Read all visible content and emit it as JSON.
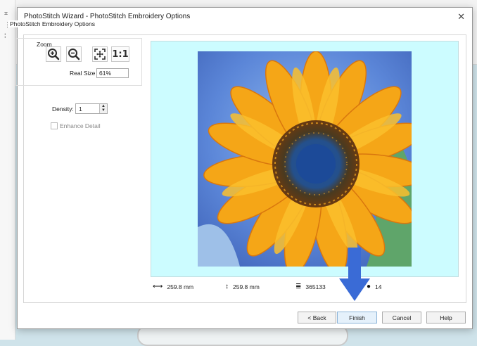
{
  "window": {
    "title": "PhotoStitch Wizard - PhotoStitch Embroidery Options",
    "close_glyph": "✕"
  },
  "group": {
    "label": "PhotoStitch Embroidery Options"
  },
  "zoom": {
    "label": "Zoom",
    "buttons": [
      "zoom-in-icon",
      "zoom-out-icon",
      "fit-to-window-icon",
      "actual-size-icon"
    ],
    "actual_size_text": "1:1",
    "real_size_label": "Real Size",
    "real_size_value": "61%"
  },
  "density": {
    "label": "Density:",
    "value": "1"
  },
  "enhance_detail": {
    "label": "Enhance Detail",
    "checked": false,
    "enabled": false
  },
  "preview": {
    "image": "sunflower-embroidery-preview",
    "background": "#ccfcff"
  },
  "stats": {
    "width": "259.8 mm",
    "height": "259.8 mm",
    "stitches": "365133",
    "colors": "14"
  },
  "footer": {
    "back_label": "< Back",
    "finish_label": "Finish",
    "cancel_label": "Cancel",
    "help_label": "Help"
  },
  "annotation": {
    "arrow_color": "#3a6bd6"
  }
}
